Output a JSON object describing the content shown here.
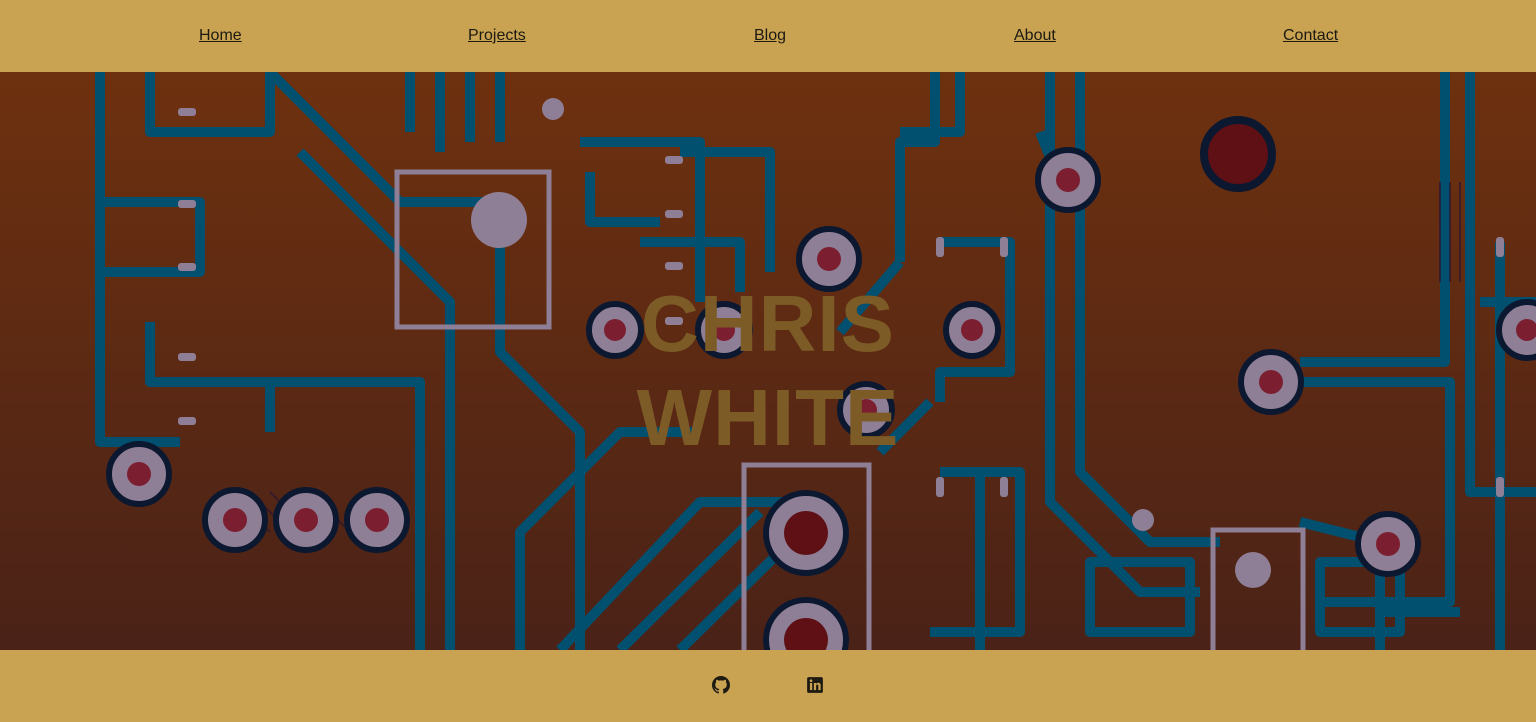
{
  "nav": {
    "items": [
      {
        "label": "Home"
      },
      {
        "label": "Projects"
      },
      {
        "label": "Blog"
      },
      {
        "label": "About"
      },
      {
        "label": "Contact"
      }
    ]
  },
  "hero": {
    "name_line1": "CHRIS",
    "name_line2": "WHITE"
  },
  "footer": {
    "icons": [
      "github-icon",
      "linkedin-icon"
    ]
  },
  "colors": {
    "bar": "#c9a352",
    "board_top": "#6e310f",
    "board_bottom": "#4a2217",
    "trace": "#02506f",
    "pad": "#8f7f96",
    "hole": "#7b1f30",
    "name": "#7c5b26",
    "text": "#1d1a12"
  }
}
